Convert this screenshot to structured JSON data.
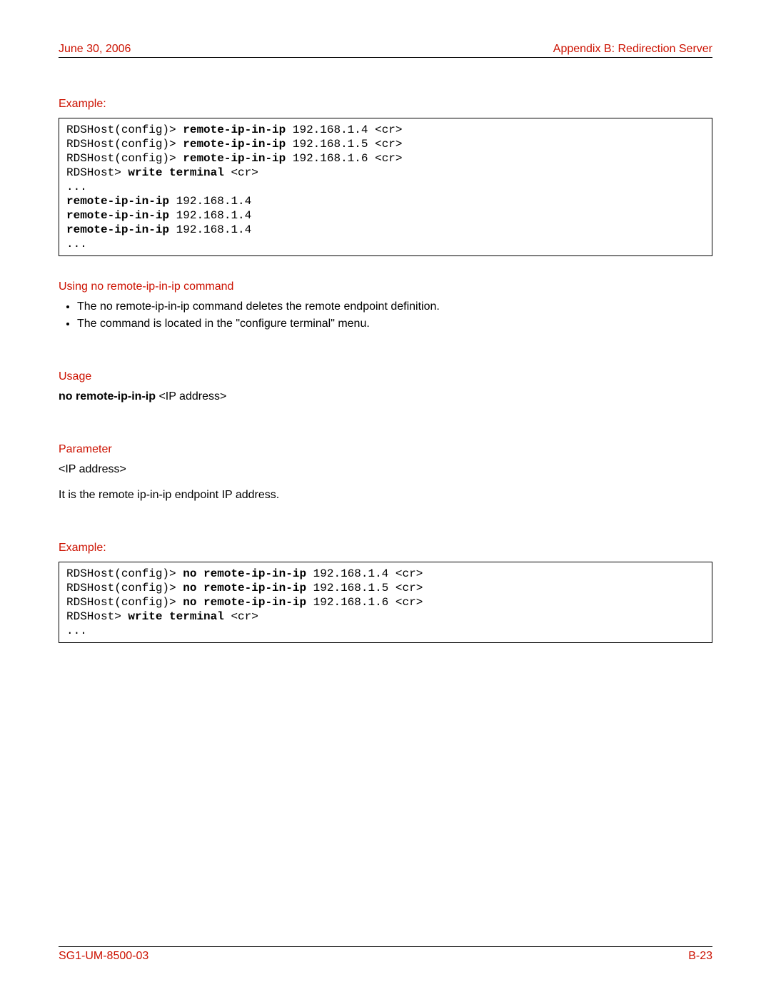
{
  "header": {
    "date": "June 30, 2006",
    "appendix": "Appendix B: Redirection Server"
  },
  "sections": {
    "example1_heading": "Example:",
    "code1": {
      "l1_a": "RDSHost(config)> ",
      "l1_b": "remote-ip-in-ip",
      "l1_c": " 192.168.1.4 <cr>",
      "l2_a": "RDSHost(config)> ",
      "l2_b": "remote-ip-in-ip",
      "l2_c": " 192.168.1.5 <cr>",
      "l3_a": "RDSHost(config)> ",
      "l3_b": "remote-ip-in-ip",
      "l3_c": " 192.168.1.6 <cr>",
      "l4_a": "RDSHost> ",
      "l4_b": "write terminal",
      "l4_c": " <cr>",
      "l5": "...",
      "l6_b": "remote-ip-in-ip",
      "l6_c": " 192.168.1.4",
      "l7_b": "remote-ip-in-ip",
      "l7_c": " 192.168.1.4",
      "l8_b": "remote-ip-in-ip",
      "l8_c": " 192.168.1.4",
      "l9": "..."
    },
    "using_heading": "Using no remote-ip-in-ip command",
    "bullets": [
      "The no remote-ip-in-ip command deletes the remote endpoint definition.",
      "The command is located in the \"configure terminal\" menu."
    ],
    "usage_heading": "Usage",
    "usage_bold": "no remote-ip-in-ip ",
    "usage_rest": "<IP address>",
    "parameter_heading": "Parameter",
    "parameter_line1": "<IP address>",
    "parameter_line2": "It is the remote ip-in-ip endpoint IP address.",
    "example2_heading": "Example:",
    "code2": {
      "l1_a": "RDSHost(config)> ",
      "l1_b": "no remote-ip-in-ip",
      "l1_c": " 192.168.1.4 <cr>",
      "l2_a": "RDSHost(config)> ",
      "l2_b": "no remote-ip-in-ip",
      "l2_c": " 192.168.1.5 <cr>",
      "l3_a": "RDSHost(config)> ",
      "l3_b": "no remote-ip-in-ip",
      "l3_c": " 192.168.1.6 <cr>",
      "l4_a": "RDSHost> ",
      "l4_b": "write terminal",
      "l4_c": " <cr>",
      "l5": "..."
    }
  },
  "footer": {
    "docid": "SG1-UM-8500-03",
    "pagenum": "B-23"
  }
}
